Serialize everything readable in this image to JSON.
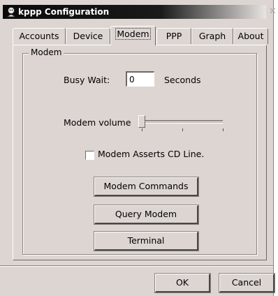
{
  "window": {
    "title": "kppp Configuration"
  },
  "tabs": [
    {
      "label": "Accounts"
    },
    {
      "label": "Device"
    },
    {
      "label": "Modem",
      "active": true
    },
    {
      "label": "PPP"
    },
    {
      "label": "Graph"
    },
    {
      "label": "About"
    }
  ],
  "modem_group": {
    "title": "Modem",
    "busy_wait_label": "Busy Wait:",
    "busy_wait_value": "0",
    "busy_wait_unit": "Seconds",
    "volume_label": "Modem volume",
    "volume_level": 0,
    "cd_line_label": "Modem Asserts CD Line.",
    "cd_line_checked": false,
    "buttons": {
      "modem_commands": "Modem Commands",
      "query_modem": "Query Modem",
      "terminal": "Terminal"
    }
  },
  "dialog_buttons": {
    "ok": "OK",
    "cancel": "Cancel"
  },
  "colors": {
    "window_bg": "#dcd5d2",
    "titlebar_bg": "#0a0a0a",
    "title_text": "#ffffff"
  },
  "icons": {
    "app": "kppp-app-icon",
    "close": "close-icon"
  }
}
